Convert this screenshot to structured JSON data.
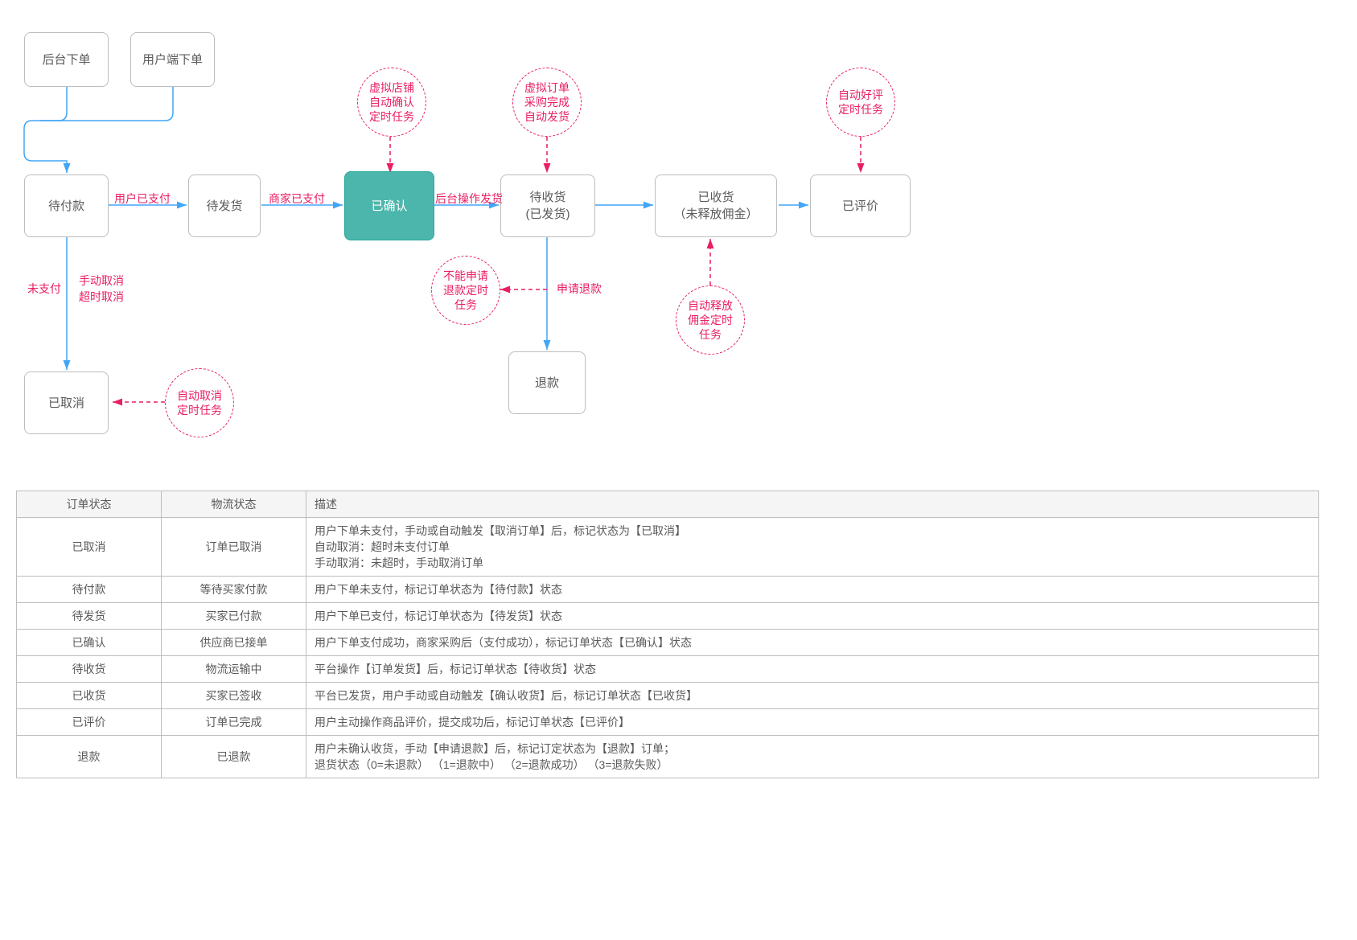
{
  "diagram": {
    "nodes": {
      "backend_order": "后台下单",
      "client_order": "用户端下单",
      "pending_pay": "待付款",
      "pending_ship": "待发货",
      "confirmed": "已确认",
      "pending_receive": "待收货\n(已发货)",
      "received": "已收货\n（未释放佣金）",
      "reviewed": "已评价",
      "cancelled": "已取消",
      "refund": "退款"
    },
    "bubbles": {
      "virtual_shop_confirm": "虚拟店铺\n自动确认\n定时任务",
      "virtual_order_ship": "虚拟订单\n采购完成\n自动发货",
      "auto_review": "自动好评\n定时任务",
      "cannot_refund": "不能申请\n退款定时\n任务",
      "release_commission": "自动释放\n佣金定时\n任务",
      "auto_cancel": "自动取消\n定时任务"
    },
    "edge_labels": {
      "user_paid": "用户已支付",
      "merchant_paid": "商家已支付",
      "backend_ship": "后台操作发货",
      "unpaid": "未支付",
      "cancel_reasons": "手动取消\n超时取消",
      "apply_refund": "申请退款"
    }
  },
  "table": {
    "headers": {
      "a": "订单状态",
      "b": "物流状态",
      "c": "描述"
    },
    "rows": [
      {
        "a": "已取消",
        "b": "订单已取消",
        "c": "用户下单未支付，手动或自动触发【取消订单】后，标记状态为【已取消】\n自动取消：超时未支付订单\n手动取消：未超时，手动取消订单"
      },
      {
        "a": "待付款",
        "b": "等待买家付款",
        "c": "用户下单未支付，标记订单状态为【待付款】状态"
      },
      {
        "a": "待发货",
        "b": "买家已付款",
        "c": "用户下单已支付，标记订单状态为【待发货】状态"
      },
      {
        "a": "已确认",
        "b": "供应商已接单",
        "c": "用户下单支付成功，商家采购后（支付成功），标记订单状态【已确认】状态"
      },
      {
        "a": "待收货",
        "b": "物流运输中",
        "c": "平台操作【订单发货】后，标记订单状态【待收货】状态"
      },
      {
        "a": "已收货",
        "b": "买家已签收",
        "c": "平台已发货，用户手动或自动触发【确认收货】后，标记订单状态【已收货】"
      },
      {
        "a": "已评价",
        "b": "订单已完成",
        "c": "用户主动操作商品评价，提交成功后，标记订单状态【已评价】"
      },
      {
        "a": "退款",
        "b": "已退款",
        "c": "用户未确认收货，手动【申请退款】后，标记订定状态为【退款】订单；\n退货状态（0=未退款）  （1=退款中）  （2=退款成功）  （3=退款失败）"
      }
    ]
  }
}
